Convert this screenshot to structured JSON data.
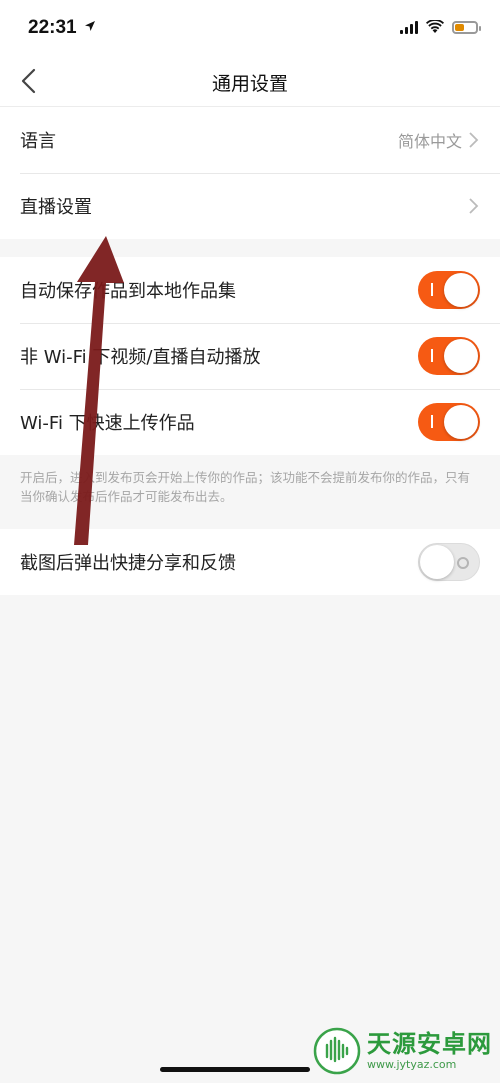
{
  "status_bar": {
    "time": "22:31"
  },
  "nav": {
    "title": "通用设置"
  },
  "general": {
    "language_label": "语言",
    "language_value": "简体中文",
    "live_settings_label": "直播设置"
  },
  "toggles": {
    "auto_save_label": "自动保存作品到本地作品集",
    "auto_save_on": true,
    "autoplay_label": "非 Wi-Fi 下视频/直播自动播放",
    "autoplay_on": true,
    "fast_upload_label": "Wi-Fi 下快速上传作品",
    "fast_upload_on": true
  },
  "hint": {
    "text": "开启后，进入到发布页会开始上传你的作品；该功能不会提前发布你的作品，只有当你确认发布后作品才可能发布出去。"
  },
  "screenshot_share": {
    "label": "截图后弹出快捷分享和反馈",
    "on": false
  },
  "watermark": {
    "name": "天源安卓网",
    "url": "www.jytyaz.com"
  },
  "colors": {
    "toggle_on": "#f65a13",
    "arrow": "#7a1a1a",
    "watermark": "#2c9a3c"
  },
  "icons": [
    "location-arrow-icon",
    "signal-icon",
    "wifi-icon",
    "battery-icon",
    "back-icon",
    "chevron-right-icon",
    "watermark-logo-icon"
  ]
}
